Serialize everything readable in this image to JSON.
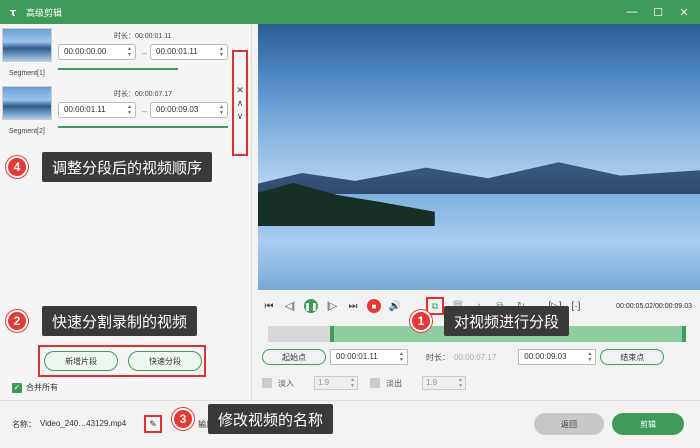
{
  "app": {
    "title": "高级剪辑",
    "logo": "ꚍ",
    "win_min": "—",
    "win_max": "☐",
    "win_close": "✕"
  },
  "segments": [
    {
      "label": "Segment[1]",
      "duration": "时长：00:00:01.11",
      "start": "00:00:00.00",
      "end": "00:00:01.11"
    },
    {
      "label": "Segment[2]",
      "duration": "时长：00:00:07.17",
      "start": "00:00:01.11",
      "end": "00:00:09.03"
    }
  ],
  "order_controls": {
    "close": "✕",
    "up": "∧",
    "down": "∨"
  },
  "callouts": [
    {
      "num": "4",
      "text": "调整分段后的视频顺序"
    },
    {
      "num": "2",
      "text": "快速分割录制的视频"
    },
    {
      "num": "1",
      "text": "对视频进行分段"
    },
    {
      "num": "3",
      "text": "修改视频的名称"
    }
  ],
  "buttons": {
    "new_segment": "新增片段",
    "quick_split": "快速分段",
    "merge_all": "合并所有",
    "return": "返回",
    "cut": "剪辑"
  },
  "playback": {
    "timecode": "00:00:05.02/00:00:09.03",
    "icons": [
      "⏮",
      "◁|",
      "❚❚",
      "|▷",
      "⏭",
      "■",
      "🔊",
      "⧉",
      "🗑",
      "+",
      "⧉",
      "↻",
      "[▷]",
      "[·]"
    ]
  },
  "set_edit": {
    "start_point": "起始点",
    "start_time": "00:00:01.11",
    "duration_label": "时长：",
    "duration_value": "00:00:07.17",
    "end_time": "00:00:09.03",
    "end_point": "结束点"
  },
  "fades": {
    "fade_in_label": "淡入",
    "fade_in_value": "1.9",
    "fade_out_label": "淡出",
    "fade_out_value": "1.9"
  },
  "footer": {
    "name_label": "名称：",
    "name_value": "Video_240…43129.mp4",
    "out_label": "输出"
  },
  "colors": {
    "accent": "#3e9b5a",
    "highlight": "#e0312e",
    "badge": "#e53935"
  }
}
